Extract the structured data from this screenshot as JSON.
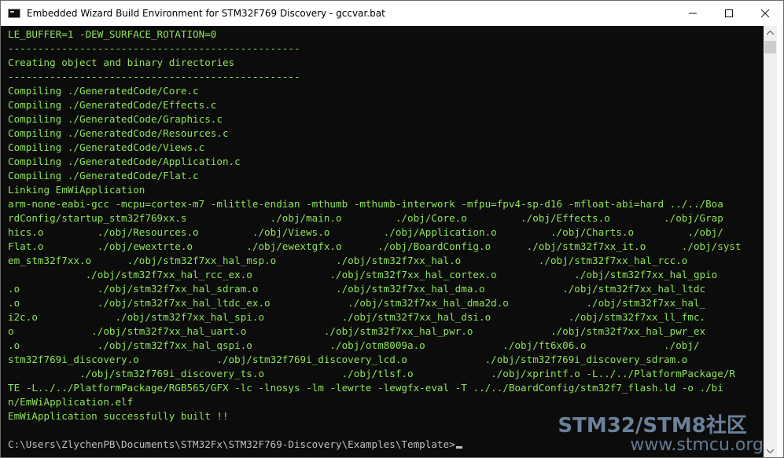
{
  "window": {
    "title": "Embedded Wizard Build Environment for STM32F769 Discovery - gccvar.bat",
    "icon": "console-icon",
    "controls": [
      "minimize-icon",
      "maximize-icon",
      "close-icon"
    ]
  },
  "console": {
    "lines": [
      "LE_BUFFER=1 -DEW_SURFACE_ROTATION=0",
      "-------------------------------------------------",
      "Creating object and binary directories",
      "-------------------------------------------------",
      "Compiling ./GeneratedCode/Core.c",
      "Compiling ./GeneratedCode/Effects.c",
      "Compiling ./GeneratedCode/Graphics.c",
      "Compiling ./GeneratedCode/Resources.c",
      "Compiling ./GeneratedCode/Views.c",
      "Compiling ./GeneratedCode/Application.c",
      "Compiling ./GeneratedCode/Flat.c",
      "Linking EmWiApplication",
      "arm-none-eabi-gcc -mcpu=cortex-m7 -mlittle-endian -mthumb -mthumb-interwork -mfpu=fpv4-sp-d16 -mfloat-abi=hard ../../Boa",
      "rdConfig/startup_stm32f769xx.s              ./obj/main.o         ./obj/Core.o         ./obj/Effects.o         ./obj/Grap",
      "hics.o         ./obj/Resources.o         ./obj/Views.o         ./obj/Application.o         ./obj/Charts.o         ./obj/",
      "Flat.o         ./obj/ewextrte.o         ./obj/ewextgfx.o      ./obj/BoardConfig.o      ./obj/stm32f7xx_it.o      ./obj/syst",
      "em_stm32f7xx.o      ./obj/stm32f7xx_hal_msp.o          ./obj/stm32f7xx_hal.o             ./obj/stm32f7xx_hal_rcc.o",
      "             ./obj/stm32f7xx_hal_rcc_ex.o             ./obj/stm32f7xx_hal_cortex.o             ./obj/stm32f7xx_hal_gpio",
      ".o             ./obj/stm32f7xx_hal_sdram.o             ./obj/stm32f7xx_hal_dma.o             ./obj/stm32f7xx_hal_ltdc",
      ".o             ./obj/stm32f7xx_hal_ltdc_ex.o             ./obj/stm32f7xx_hal_dma2d.o             ./obj/stm32f7xx_hal_",
      "i2c.o             ./obj/stm32f7xx_hal_spi.o             ./obj/stm32f7xx_hal_dsi.o             ./obj/stm32f7xx_ll_fmc.",
      "o             ./obj/stm32f7xx_hal_uart.o             ./obj/stm32f7xx_hal_pwr.o             ./obj/stm32f7xx_hal_pwr_ex",
      ".o             ./obj/stm32f7xx_hal_qspi.o             ./obj/otm8009a.o             ./obj/ft6x06.o             ./obj/",
      "stm32f769i_discovery.o             ./obj/stm32f769i_discovery_lcd.o             ./obj/stm32f769i_discovery_sdram.o",
      "            ./obj/stm32f769i_discovery_ts.o             ./obj/tlsf.o             ./obj/xprintf.o -L../../PlatformPackage/R",
      "TE -L../../PlatformPackage/RGB565/GFX -lc -lnosys -lm -lewrte -lewgfx-eval -T ../../BoardConfig/stm32f7_flash.ld -o ./bi",
      "n/EmWiApplication.elf",
      "EmWiApplication successfully built !!",
      ""
    ],
    "prompt": "C:\\Users\\ZlychenPB\\Documents\\STM32Fx\\STM32F769-Discovery\\Examples\\Template>"
  },
  "watermark": {
    "main": "STM32/STM8社区",
    "sub": "www.stmcu.org"
  }
}
